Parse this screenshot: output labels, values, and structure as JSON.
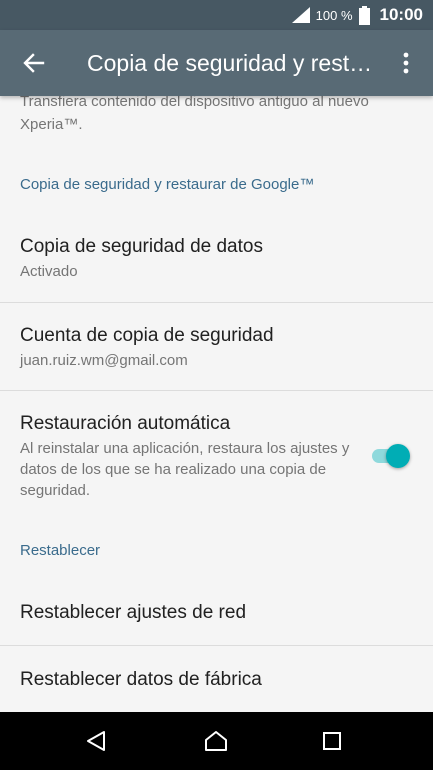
{
  "status_bar": {
    "battery": "100 %",
    "time": "10:00",
    "icons": [
      "signal-icon",
      "battery-icon"
    ]
  },
  "app_bar": {
    "title": "Copia de seguridad y restaurar",
    "icons": [
      "back-arrow-icon",
      "more-vert-icon"
    ]
  },
  "content": {
    "partial_summary": "Transfiera contenido del dispositivo antiguo al nuevo Xperia™.",
    "sections": [
      {
        "header": "Copia de seguridad y restaurar de Google™",
        "items": [
          {
            "title": "Copia de seguridad de datos",
            "summary": "Activado"
          },
          {
            "title": "Cuenta de copia de seguridad",
            "summary": "juan.ruiz.wm@gmail.com"
          },
          {
            "title": "Restauración automática",
            "summary": "Al reinstalar una aplicación, restaura los ajustes y datos de los que se ha realizado una copia de seguridad.",
            "toggle_on": true
          }
        ]
      },
      {
        "header": "Restablecer",
        "items": [
          {
            "title": "Restablecer ajustes de red"
          },
          {
            "title": "Restablecer datos de fábrica"
          }
        ]
      }
    ]
  },
  "nav_bar": {
    "icons": [
      "back-triangle-icon",
      "home-icon",
      "recents-icon"
    ]
  },
  "colors": {
    "status_bar": "#475863",
    "app_bar": "#586a75",
    "accent": "#00adb5",
    "section_header": "#3a6b8c"
  }
}
